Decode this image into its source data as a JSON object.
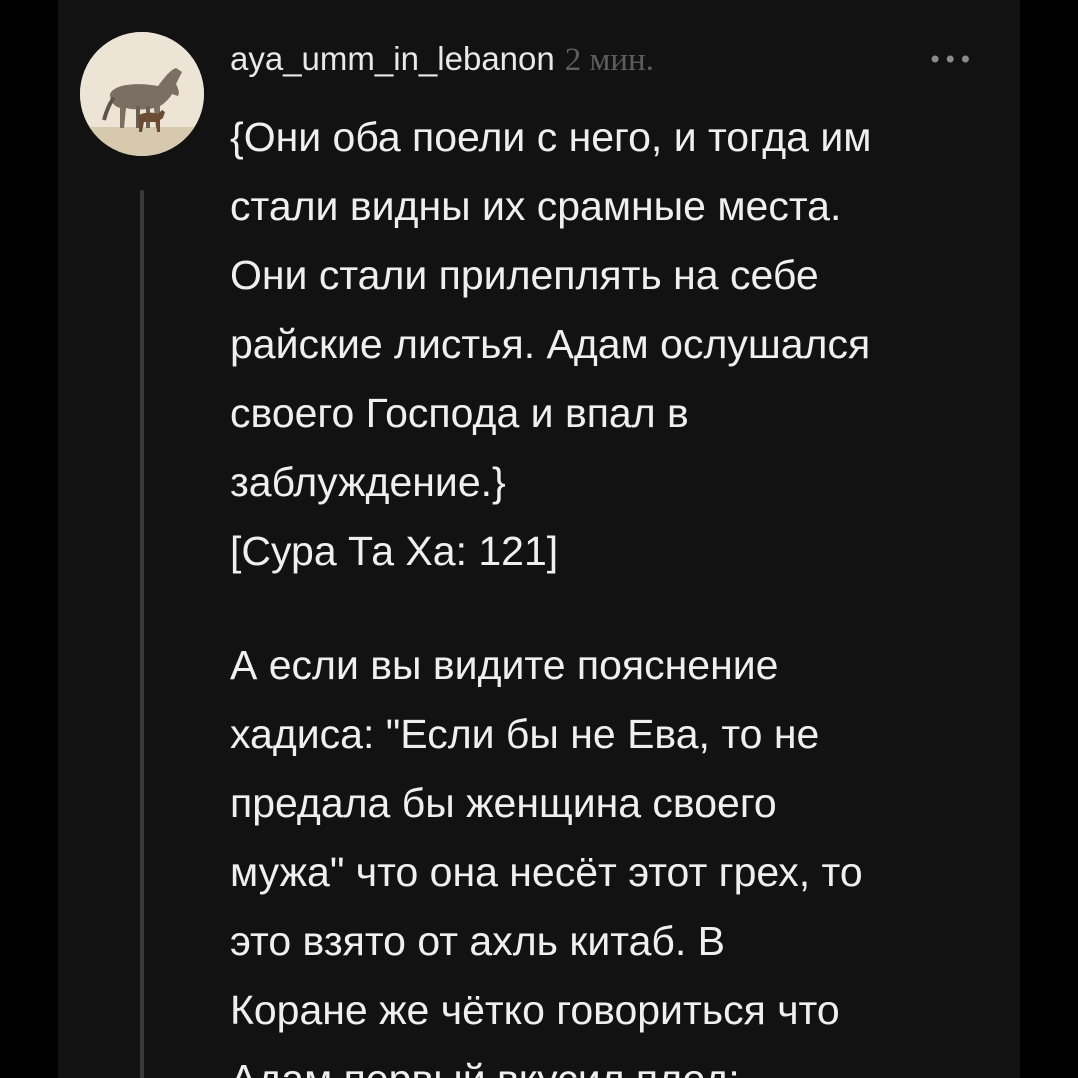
{
  "comment": {
    "author": "aya_umm_in_lebanon",
    "time": "2 мин.",
    "more_icon": "more-horizontal-icon",
    "paragraphs": [
      "{Они оба поели с него, и тогда им\nстали видны их срамные места.\nОни стали прилеплять на себе\nрайские листья. Адам ослушался\nсвоего Господа и впал в\nзаблуждение.}\n[Сура Та Ха: 121]",
      "А если вы видите пояснение\nхадиса: \"Если бы не Ева, то не\nпредала бы женщина своего\nмужа\" что она несёт этот грех, то\nэто взято от ахль китаб. В\nКоране же чётко говориться что\nАдам первый вкусил плод:"
    ]
  },
  "colors": {
    "background": "#000000",
    "panel": "#121212",
    "text": "#efefef",
    "muted": "#5d5d5d",
    "thread_line": "#3a3a3a"
  }
}
